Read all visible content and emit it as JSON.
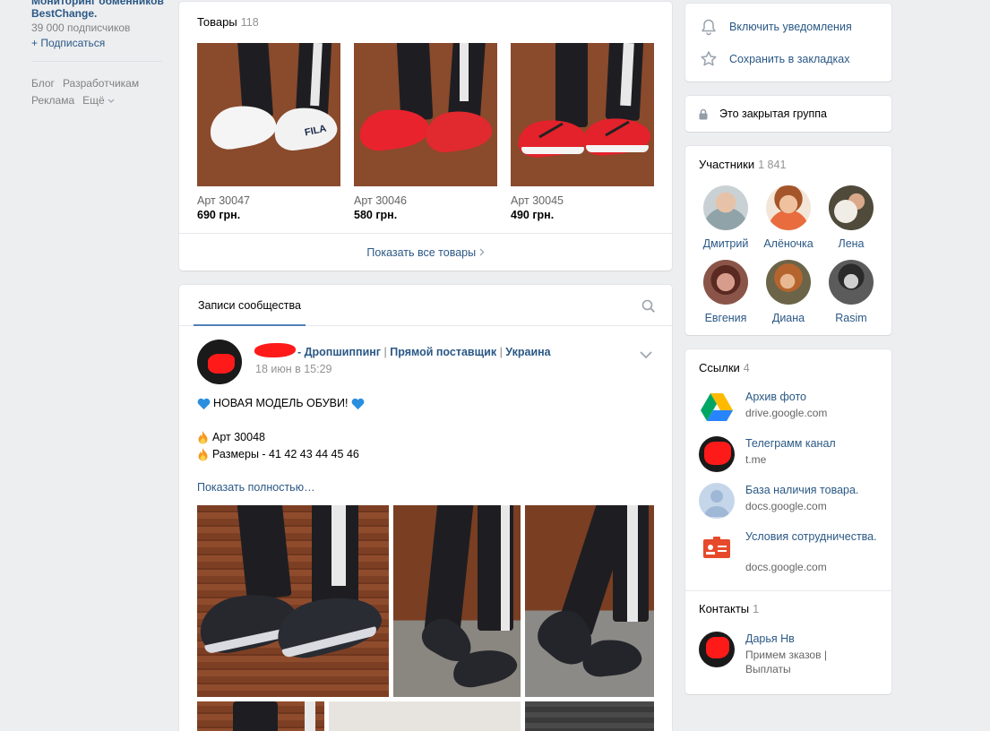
{
  "left": {
    "group_name": "Мониторинг обменников BestChange.",
    "subscribers": "39 000 подписчиков",
    "subscribe": "+ Подписаться",
    "links": [
      "Блог",
      "Разработчикам",
      "Реклама",
      "Ещё"
    ]
  },
  "goods": {
    "title": "Товары",
    "count": "118",
    "items": [
      {
        "art": "Арт 30047",
        "price": "690 грн."
      },
      {
        "art": "Арт 30046",
        "price": "580 грн."
      },
      {
        "art": "Арт 30045",
        "price": "490 грн."
      }
    ],
    "show_all": "Показать все товары"
  },
  "posts": {
    "tab": "Записи сообщества",
    "author_parts": [
      "- Дропшиппинг",
      "|",
      "Прямой поставщик",
      "|",
      "Украина"
    ],
    "date": "18 июн в 15:29",
    "text": {
      "line1": "НОВАЯ МОДЕЛЬ ОБУВИ!",
      "line2": "Арт 30048",
      "line3": "Размеры - 41 42 43 44 45 46"
    },
    "show_full": "Показать полностью…"
  },
  "actions": {
    "notify": "Включить уведомления",
    "bookmark": "Сохранить в закладках"
  },
  "closed": "Это закрытая группа",
  "members": {
    "title": "Участники",
    "count": "1 841",
    "list": [
      "Дмитрий",
      "Алёночка",
      "Лена",
      "Евгения",
      "Диана",
      "Rasim"
    ]
  },
  "links": {
    "title": "Ссылки",
    "count": "4",
    "items": [
      {
        "title": "Архив фото",
        "sub": "drive.google.com"
      },
      {
        "title": "Телеграмм канал",
        "sub": "t.me"
      },
      {
        "title": "База наличия товара.",
        "sub": "docs.google.com"
      },
      {
        "title": "Условия сотрудничества.",
        "sub": "docs.google.com"
      }
    ]
  },
  "contacts": {
    "title": "Контакты",
    "count": "1",
    "name": "Дарья Нв",
    "desc": "Примем зказов | Выплаты"
  },
  "colors": {
    "link": "#2a5885",
    "accent": "#5181b8",
    "background": "#edeef0"
  }
}
